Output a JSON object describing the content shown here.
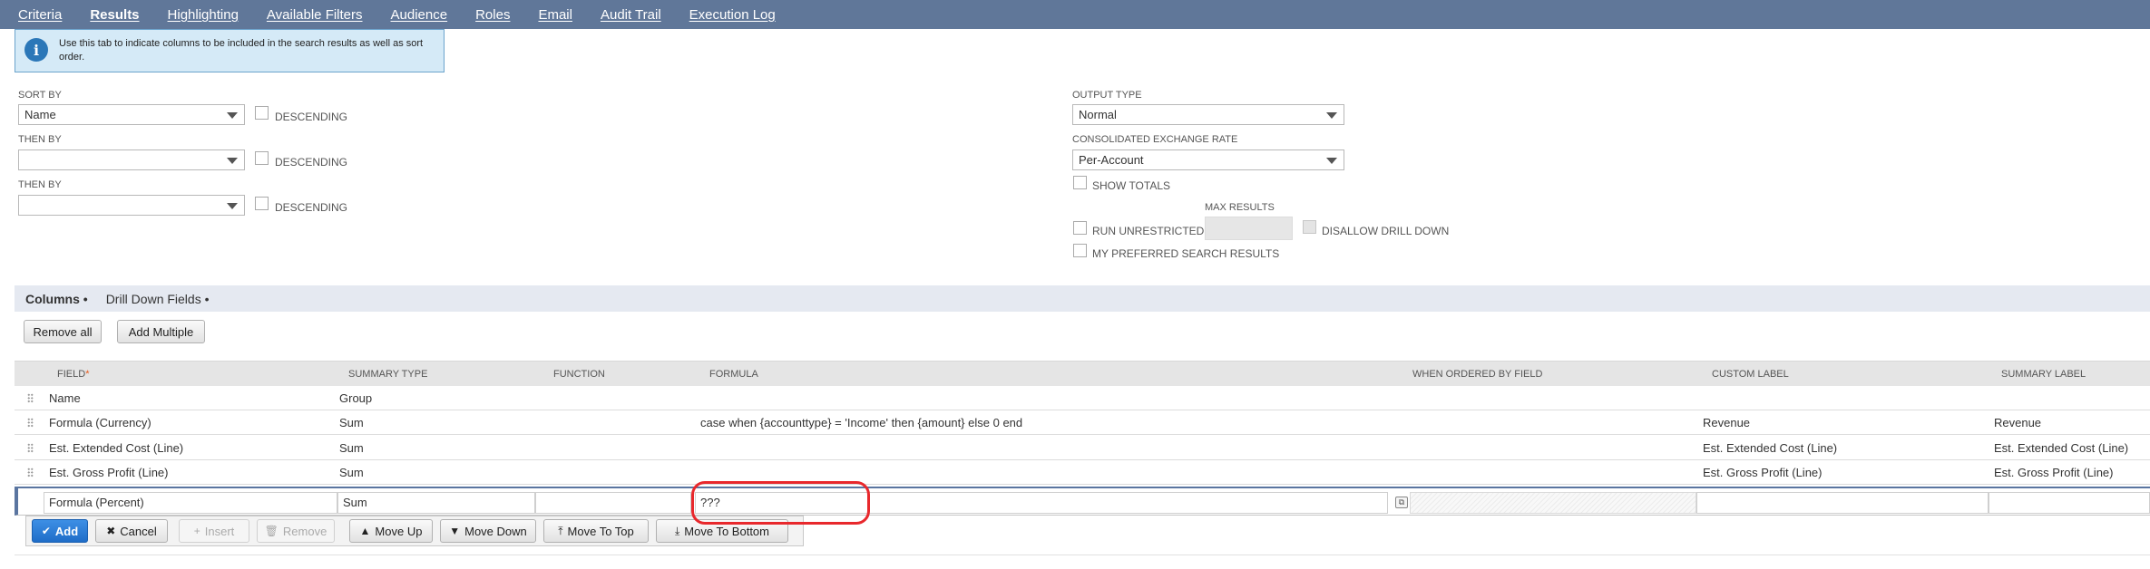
{
  "tabs": [
    "Criteria",
    "Results",
    "Highlighting",
    "Available Filters",
    "Audience",
    "Roles",
    "Email",
    "Audit Trail",
    "Execution Log"
  ],
  "active_tab": "Results",
  "info": {
    "icon": "info-icon",
    "text": "Use this tab to indicate columns to be included in the search results as well as sort order."
  },
  "sort": {
    "sort_by": {
      "label": "SORT BY",
      "value": "Name",
      "descending_label": "DESCENDING"
    },
    "then_by_1": {
      "label": "THEN BY",
      "value": "",
      "descending_label": "DESCENDING"
    },
    "then_by_2": {
      "label": "THEN BY",
      "value": "",
      "descending_label": "DESCENDING"
    }
  },
  "output": {
    "output_type": {
      "label": "OUTPUT TYPE",
      "value": "Normal"
    },
    "exchange_rate": {
      "label": "CONSOLIDATED EXCHANGE RATE",
      "value": "Per-Account"
    },
    "show_totals": "SHOW TOTALS",
    "max_results": "MAX RESULTS",
    "run_unrestricted": "RUN UNRESTRICTED",
    "disallow_drill_down": "DISALLOW DRILL DOWN",
    "preferred_results": "MY PREFERRED SEARCH RESULTS"
  },
  "subtabs": [
    "Columns •",
    "Drill Down Fields •"
  ],
  "buttons": {
    "remove_all": "Remove all",
    "add_multiple": "Add Multiple"
  },
  "columns_header": {
    "field": "FIELD",
    "required_mark": "*",
    "summary_type": "SUMMARY TYPE",
    "function": "FUNCTION",
    "formula": "FORMULA",
    "when_ordered_by_field": "WHEN ORDERED BY FIELD",
    "custom_label": "CUSTOM LABEL",
    "summary_label": "SUMMARY LABEL"
  },
  "rows": [
    {
      "field": "Name",
      "summary_type": "Group",
      "formula": "",
      "custom_label": "",
      "summary_label": ""
    },
    {
      "field": "Formula (Currency)",
      "summary_type": "Sum",
      "formula": "case when {accounttype} = 'Income' then {amount} else 0 end",
      "custom_label": "Revenue",
      "summary_label": "Revenue"
    },
    {
      "field": "Est. Extended Cost (Line)",
      "summary_type": "Sum",
      "formula": "",
      "custom_label": "Est. Extended Cost (Line)",
      "summary_label": "Est. Extended Cost (Line)"
    },
    {
      "field": "Est. Gross Profit (Line)",
      "summary_type": "Sum",
      "formula": "",
      "custom_label": "Est. Gross Profit (Line)",
      "summary_label": "Est. Gross Profit (Line)"
    }
  ],
  "edit_row": {
    "field": "Formula (Percent)",
    "summary_type": "Sum",
    "formula": "???"
  },
  "actions": {
    "add": "Add",
    "cancel": "Cancel",
    "insert": "Insert",
    "remove": "Remove",
    "move_up": "Move Up",
    "move_down": "Move Down",
    "move_to_top": "Move To Top",
    "move_to_bottom": "Move To Bottom"
  },
  "colors": {
    "tab_bar": "#607799",
    "info_bg": "#d5eaf7",
    "primary_button": "#1f6dc8",
    "highlight_circle": "#e8282c"
  }
}
